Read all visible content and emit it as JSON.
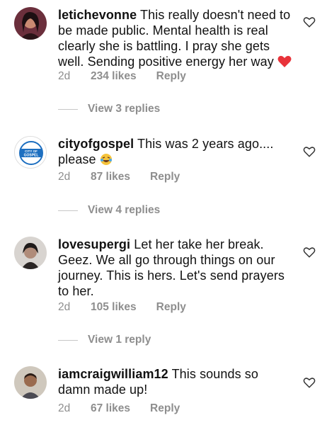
{
  "comments": [
    {
      "username": "letichevonne",
      "text": "This really doesn't need to be made public. Mental health is real clearly she is battling. I pray she gets well. Sending positive energy her way",
      "age": "2d",
      "likes": "234 likes",
      "reply": "Reply",
      "view_replies": "View 3 replies"
    },
    {
      "username": "cityofgospel",
      "text": "This was 2 years ago.... please",
      "age": "2d",
      "likes": "87 likes",
      "reply": "Reply",
      "view_replies": "View 4 replies"
    },
    {
      "username": "lovesupergi",
      "text": "Let her take her break. Geez. We all go through things on our journey. This is hers. Let's send prayers to her.",
      "age": "2d",
      "likes": "105 likes",
      "reply": "Reply",
      "view_replies": "View 1 reply"
    },
    {
      "username": "iamcraigwilliam12",
      "text": "This sounds so damn made up!",
      "age": "2d",
      "likes": "67 likes",
      "reply": "Reply"
    }
  ],
  "avatar_logo_text": [
    "CITY OF",
    "GOSPEL"
  ],
  "colors": {
    "meta": "#8e8e8e",
    "heart_emoji": "#e8333a",
    "logo_blue": "#1d6fc0"
  }
}
